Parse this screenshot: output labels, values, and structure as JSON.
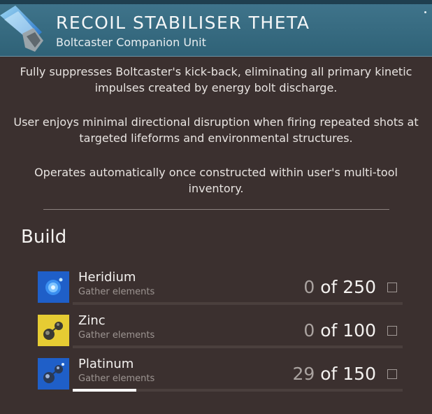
{
  "item": {
    "title": "RECOIL STABILISER THETA",
    "subtitle": "Boltcaster Companion Unit",
    "icon": "recoil-stabiliser-icon",
    "header_color": "#3a6d84"
  },
  "description": [
    "Fully suppresses Boltcaster's kick-back, eliminating all primary kinetic impulses created by energy bolt discharge.",
    "User enjoys minimal directional disruption when firing repeated shots at targeted lifeforms and environmental structures.",
    "Operates automatically once constructed within user's multi-tool inventory."
  ],
  "build": {
    "heading": "Build",
    "resources": [
      {
        "name": "Heridium",
        "hint": "Gather elements",
        "have": "0",
        "of_label": "of 250",
        "progress": 0.0,
        "icon": "heridium-icon",
        "icon_color": "#1f5fc8"
      },
      {
        "name": "Zinc",
        "hint": "Gather elements",
        "have": "0",
        "of_label": "of 100",
        "progress": 0.0,
        "icon": "zinc-icon",
        "icon_color": "#e6cc33"
      },
      {
        "name": "Platinum",
        "hint": "Gather elements",
        "have": "29",
        "of_label": "of 150",
        "progress": 0.193,
        "icon": "platinum-icon",
        "icon_color": "#1f5fc8"
      }
    ]
  }
}
